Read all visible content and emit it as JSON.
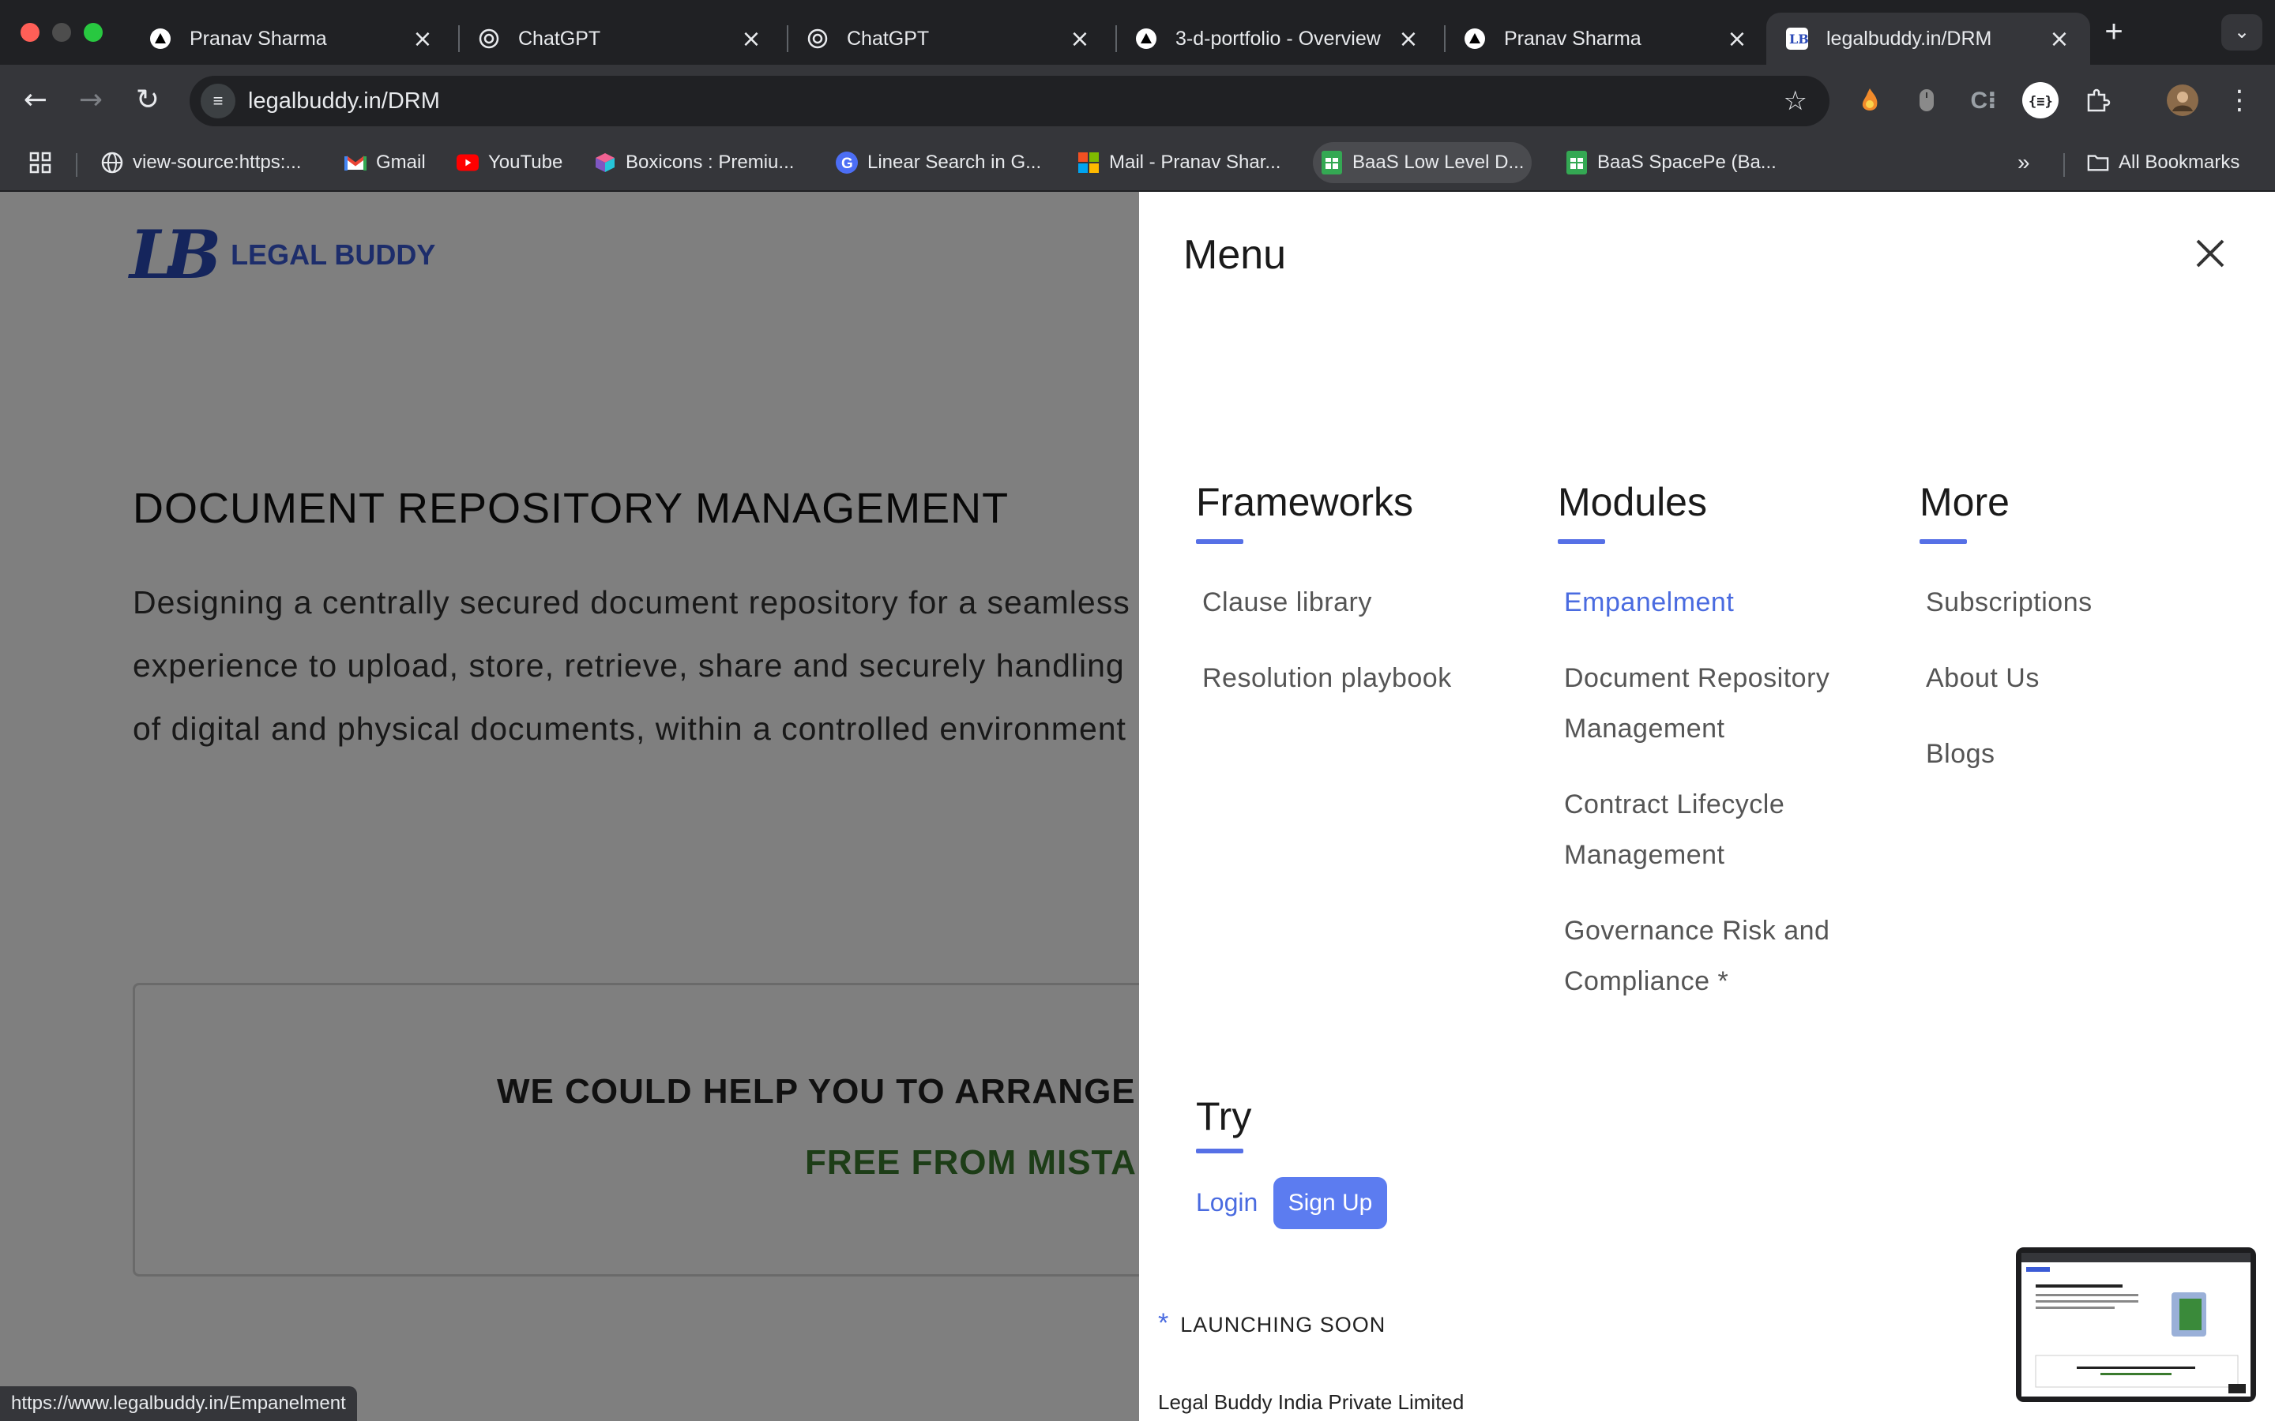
{
  "window": {
    "traffic_colors": [
      "#ff5f57",
      "#4d4d4d",
      "#28c840"
    ]
  },
  "tabs": [
    {
      "title": "Pranav Sharma",
      "icon": "triangle-icon"
    },
    {
      "title": "ChatGPT",
      "icon": "openai-icon"
    },
    {
      "title": "ChatGPT",
      "icon": "openai-icon"
    },
    {
      "title": "3-d-portfolio - Overview",
      "icon": "triangle-icon"
    },
    {
      "title": "Pranav Sharma",
      "icon": "triangle-icon"
    },
    {
      "title": "legalbuddy.in/DRM",
      "icon": "lb-icon",
      "active": true
    }
  ],
  "toolbar": {
    "url_host": "legalbuddy.in",
    "url_path": "/DRM"
  },
  "bookmarks": [
    {
      "label": "view-source:https:...",
      "icon": "globe-icon"
    },
    {
      "label": "Gmail",
      "icon": "gmail-icon"
    },
    {
      "label": "YouTube",
      "icon": "youtube-icon"
    },
    {
      "label": "Boxicons : Premiu...",
      "icon": "boxicons-icon"
    },
    {
      "label": "Linear Search in G...",
      "icon": "google-icon"
    },
    {
      "label": "Mail - Pranav Shar...",
      "icon": "microsoft-icon"
    },
    {
      "label": "BaaS Low Level D...",
      "icon": "sheets-icon"
    },
    {
      "label": "BaaS SpacePe (Ba...",
      "icon": "sheets-icon"
    }
  ],
  "all_bookmarks": "All Bookmarks",
  "page": {
    "logo_mark": "LB",
    "logo_text": "LEGAL BUDDY",
    "hero_title": "DOCUMENT REPOSITORY MANAGEMENT",
    "hero_text": "Designing a centrally secured document repository for a seamless experience to upload, store, retrieve, share and securely handling of digital and physical documents, within a controlled environment",
    "cta_line1": "WE COULD HELP YOU TO ARRANGE A",
    "cta_line2": "FREE FROM MISTAK"
  },
  "menu": {
    "title": "Menu",
    "columns": [
      {
        "heading": "Frameworks",
        "items": [
          "Clause library",
          "Resolution playbook"
        ]
      },
      {
        "heading": "Modules",
        "items": [
          "Empanelment",
          "Document Repository Management",
          "Contract Lifecycle Management",
          "Governance Risk and Compliance *"
        ],
        "active_index": 0
      },
      {
        "heading": "More",
        "items": [
          "Subscriptions",
          "About Us",
          "Blogs"
        ]
      }
    ],
    "try_heading": "Try",
    "login": "Login",
    "signup": "Sign Up",
    "launch_marker": "*",
    "launch_text": "LAUNCHING SOON",
    "company": "Legal Buddy India Private Limited"
  },
  "status_url": "https://www.legalbuddy.in/Empanelment",
  "colors": {
    "accent": "#5c7cf0",
    "brand": "#2b4ab8",
    "cta_green": "#3a7a2e"
  }
}
